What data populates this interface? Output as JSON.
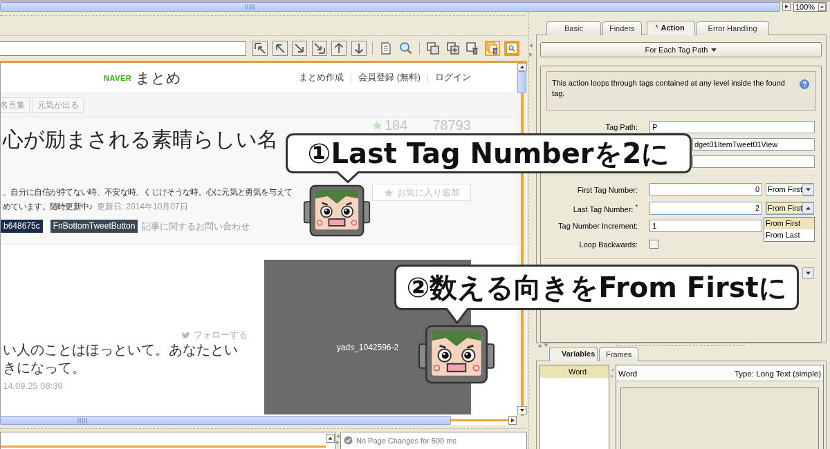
{
  "top_bar": {
    "zoom": "100%"
  },
  "toolbar": {
    "groups": [
      {
        "buttons": [
          {
            "on": false
          },
          {
            "on": false
          },
          {
            "on": false
          },
          {
            "on": false
          },
          {
            "on": false
          },
          {
            "on": false
          }
        ]
      },
      {
        "buttons": [
          {
            "on": false
          },
          {
            "on": false
          }
        ]
      },
      {
        "buttons": [
          {
            "on": false
          },
          {
            "on": false
          },
          {
            "on": false
          },
          {
            "on": true
          },
          {
            "on": true
          }
        ]
      }
    ]
  },
  "browser": {
    "logo": {
      "brand": "NAVER",
      "name": "まとめ"
    },
    "header_links": [
      "まとめ作成",
      "会員登録 (無料)",
      "ログイン"
    ],
    "tags": [
      "名言集",
      "元気が出る"
    ],
    "headline": "心が励まされる素晴らしい名",
    "star_count": "184",
    "count": "78793",
    "favorite_button": "お気に入り追加",
    "description_lines": [
      "、自分に自信が持てない時、不安な時、くじけそうな時。心に元気と勇気を与えて",
      "めています。随時更新中♪"
    ],
    "updated": "更新日: 2014年10月07日",
    "element_labels": [
      "b648675c",
      "FnBottomTweetButton"
    ],
    "contact_link": "記事に関するお問い合わせ",
    "follow_link": "フォローする",
    "tweet": "い人のことはほっといて。あなたといきになって。",
    "tweet_time": "14.09.25 08:39",
    "ad_label": "yads_1042596-2"
  },
  "status": "No Page Changes for 500 ms",
  "tabs": [
    {
      "label": "Basic",
      "selected": false
    },
    {
      "label": "Finders",
      "selected": false
    },
    {
      "mark": "*",
      "label": "Action",
      "selected": true
    },
    {
      "label": "Error Handling",
      "selected": false
    }
  ],
  "action_menu": "For Each Tag Path",
  "help_text": "This action loops through tags contained at any level inside the found tag.",
  "tag_path": {
    "label": "Tag Path:",
    "value": "P"
  },
  "covered_field": {
    "value": "dget01ItemTweet01View"
  },
  "tag_numbers": [
    {
      "label": "First Tag Number:",
      "value": "0",
      "count_from": "From First",
      "open": false
    },
    {
      "label": "Last Tag Number: $^{*}$",
      "value": "2",
      "count_from": "From First",
      "open": true,
      "options": [
        {
          "label": "From First",
          "selected": true
        },
        {
          "label": "From Last",
          "selected": false
        }
      ]
    }
  ],
  "increment": {
    "label": "Tag Number Increment:",
    "value": "1"
  },
  "loop_backwards": {
    "label": "Loop Backwards:",
    "checked": false
  },
  "bottom_tabs": [
    {
      "label": "Variables",
      "selected": true
    },
    {
      "label": "Frames",
      "selected": false
    }
  ],
  "variables": [
    {
      "name": "Word",
      "selected": true
    }
  ],
  "variable_detail": {
    "name": "Word",
    "type": "Type: Long Text (simple)"
  },
  "callouts": [
    {
      "text": "①Last Tag Numberを2に"
    },
    {
      "text": "②数える向きをFrom Firstに"
    }
  ]
}
